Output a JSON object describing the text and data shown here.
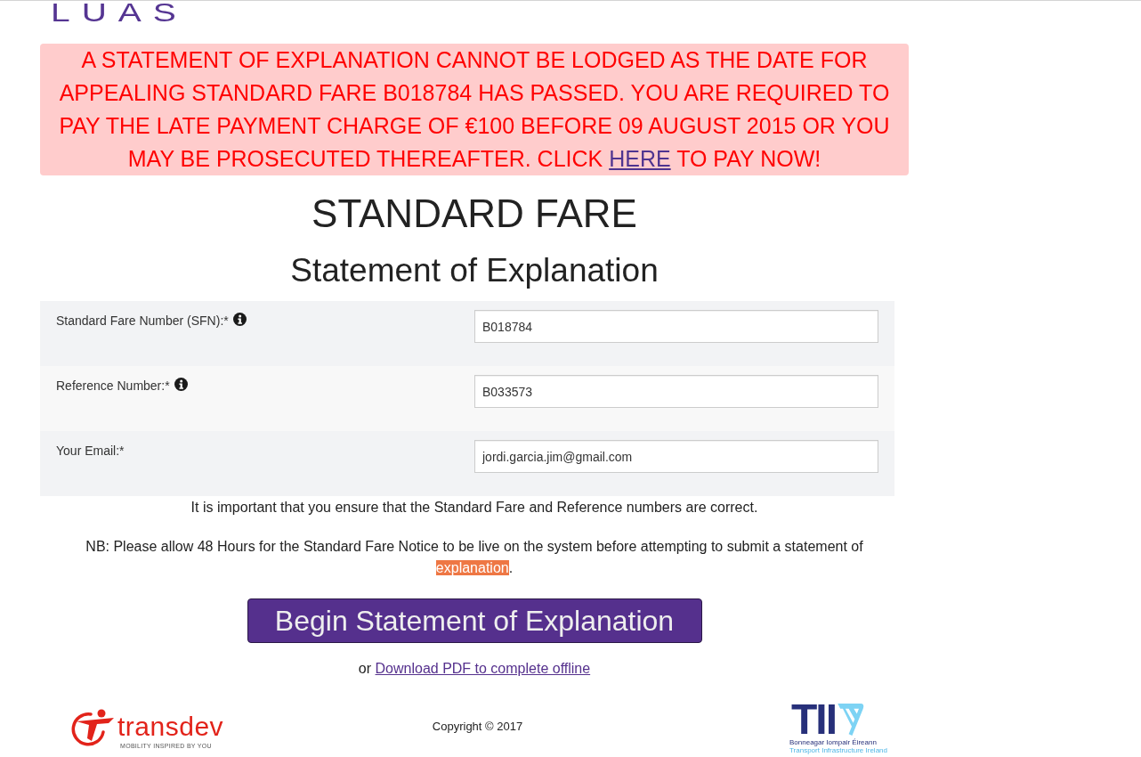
{
  "logo": {
    "text": "LUAS"
  },
  "alert": {
    "before": "A STATEMENT OF EXPLANATION CANNOT BE LODGED AS THE DATE FOR APPEALING STANDARD FARE B018784 HAS PASSED. YOU ARE REQUIRED TO PAY THE LATE PAYMENT CHARGE OF €100 BEFORE 09 AUGUST 2015 OR YOU MAY BE PROSECUTED THEREAFTER. CLICK ",
    "link": "HERE",
    "after": " TO PAY NOW!"
  },
  "heading": "STANDARD FARE",
  "subheading": "Statement of Explanation",
  "form": {
    "fields": [
      {
        "label": "Standard Fare Number (SFN):*",
        "info": true,
        "value": "B018784"
      },
      {
        "label": "Reference Number:*",
        "info": true,
        "value": "B033573"
      },
      {
        "label": "Your Email:*",
        "info": false,
        "value": "jordi.garcia.jim@gmail.com"
      }
    ]
  },
  "notice": "It is important that you ensure that the Standard Fare and Reference numbers are correct.",
  "nb_note": {
    "before": "NB: Please allow 48 Hours for the Standard Fare Notice to be live on the system before attempting to submit a statement of ",
    "highlighted": "explanation",
    "after": "."
  },
  "begin_button": "Begin Statement of Explanation",
  "pdf_line": {
    "before": "or ",
    "link": "Download PDF to complete offline"
  },
  "footer": {
    "transdev": {
      "name": "transdev",
      "tagline": "MOBILITY INSPIRED BY YOU"
    },
    "copyright": "Copyright © 2017",
    "tii": {
      "name": "TII",
      "irish": "Bonneagar Iompair Éireann",
      "english": "Transport Infrastructure Ireland"
    }
  }
}
